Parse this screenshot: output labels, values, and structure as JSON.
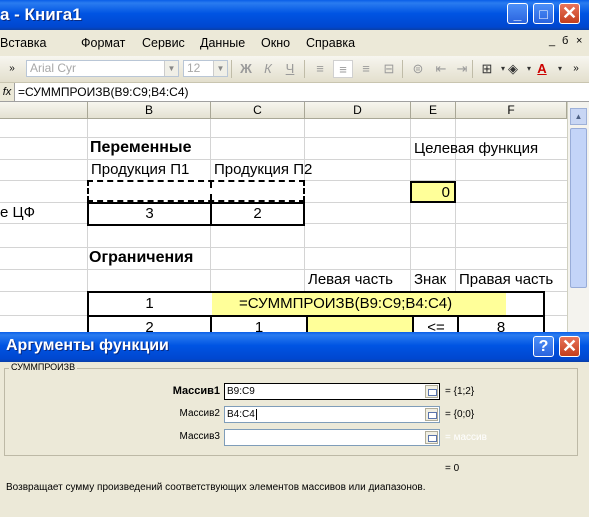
{
  "window": {
    "title": "а - Книга1",
    "min_label": "_",
    "max_label": "□",
    "close_label": "✕"
  },
  "menu": {
    "items": [
      "Вставка",
      "Формат",
      "Сервис",
      "Данные",
      "Окно",
      "Справка"
    ],
    "doc_controls": [
      "_",
      "б",
      "×"
    ]
  },
  "toolbar": {
    "font_name": "Arial Cyr",
    "font_size": "12",
    "bold_label": "Ж",
    "italic_label": "К",
    "underline_label": "Ч"
  },
  "formula_bar": {
    "fx_label": "fx",
    "formula": "=СУММПРОИЗВ(B9:C9;B4:C4)"
  },
  "columns": [
    "B",
    "C",
    "D",
    "E",
    "F"
  ],
  "cells": {
    "variables_header": "Переменные",
    "objective_header": "Целевая функция",
    "product1": "Продукция П1",
    "product2": "Продукция П2",
    "objective_value": "0",
    "coef_label": "е ЦФ",
    "coef1": "3",
    "coef2": "2",
    "constraints_header": "Ограничения",
    "left_part": "Левая часть",
    "sign": "Знак",
    "right_part": "Правая часть",
    "row1_b": "1",
    "row1_formula": "=СУММПРОИЗВ(B9:C9;B4:C4)",
    "row2_b": "2",
    "row2_c": "1",
    "row2_e": "<=",
    "row2_f": "8"
  },
  "dialog": {
    "title": "Аргументы функции",
    "help_label": "?",
    "close_label": "✕",
    "function_name": "СУММПРОИЗВ",
    "args": [
      {
        "label": "Массив1",
        "value": "B9:C9",
        "result": "= {1;2}"
      },
      {
        "label": "Массив2",
        "value": "B4:C4",
        "result": "= {0;0}"
      },
      {
        "label": "Массив3",
        "value": "",
        "result": "= массив"
      }
    ],
    "result": "= 0",
    "description": "Возвращает сумму произведений соответствующих элементов массивов или диапазонов."
  }
}
